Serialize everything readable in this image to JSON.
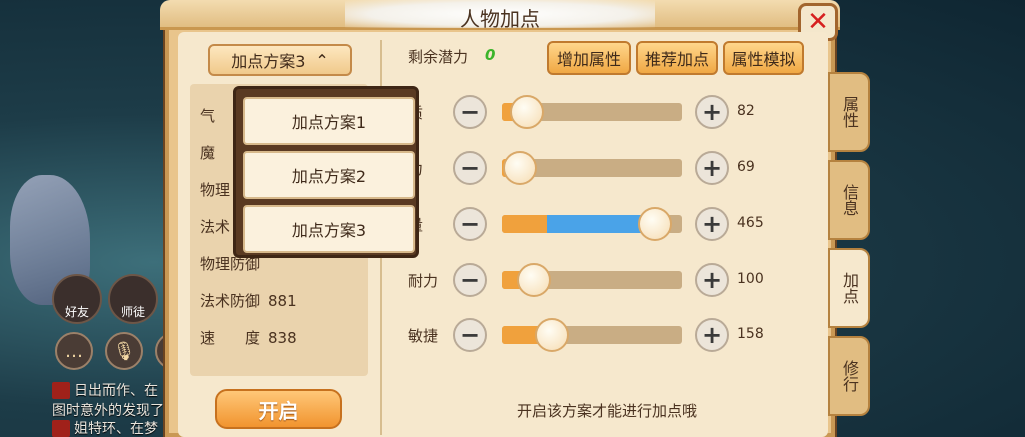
{
  "window": {
    "title": "人物加点",
    "close_icon": "close-icon"
  },
  "scheme_select": {
    "label": "加点方案3",
    "chevron": "chevron-up-icon"
  },
  "dropdown": {
    "options": [
      "加点方案1",
      "加点方案2",
      "加点方案3"
    ]
  },
  "stats": [
    {
      "label": "气",
      "value": ""
    },
    {
      "label": "魔",
      "value": ""
    },
    {
      "label": "物理",
      "value": ""
    },
    {
      "label": "法术",
      "value": ""
    },
    {
      "label": "物理防御",
      "value": ""
    },
    {
      "label": "法术防御",
      "value": "881"
    },
    {
      "label": "速　　度",
      "value": "838"
    }
  ],
  "open_button": "开启",
  "potential": {
    "label": "剩余潜力",
    "value": "0"
  },
  "actions": {
    "add_attr": "增加属性",
    "recommend": "推荐加点",
    "simulate": "属性模拟"
  },
  "attributes": [
    {
      "label": "质",
      "value": "82",
      "fill_fraction": 0.14,
      "blue_fraction": 0
    },
    {
      "label": "力",
      "value": "69",
      "fill_fraction": 0.1,
      "blue_fraction": 0
    },
    {
      "label": "量",
      "value": "465",
      "fill_fraction": 0.85,
      "blue_fraction": 0.6
    },
    {
      "label": "耐力",
      "value": "100",
      "fill_fraction": 0.18,
      "blue_fraction": 0
    },
    {
      "label": "敏捷",
      "value": "158",
      "fill_fraction": 0.28,
      "blue_fraction": 0.02
    }
  ],
  "hint": "开启该方案才能进行加点哦",
  "side_tabs": [
    "属性",
    "信息",
    "加点",
    "修行"
  ],
  "side_tab_active": 2,
  "hud": {
    "friend": "好友",
    "mentor": "师徒"
  },
  "chat": [
    {
      "text": "日出而作、在"
    },
    {
      "text": "图时意外的发现了"
    },
    {
      "text": "姐特环、在梦"
    }
  ],
  "colors": {
    "panel": "#e9c58c",
    "paper": "#f6e8cd",
    "accent_orange": "#f0a13d",
    "accent_blue": "#4aa3e8",
    "close_red": "#d61f1f",
    "potential_green": "#3bb42a"
  }
}
